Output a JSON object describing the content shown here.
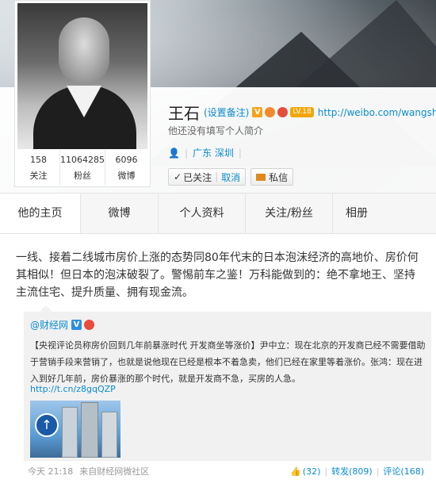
{
  "profile": {
    "name": "王石",
    "remark": "(设置备注)",
    "level": "LV.18",
    "url": "http://weibo.com/wangshi",
    "intro": "他还没有填写个人简介",
    "location": "广东 深圳",
    "follow_state": "已关注",
    "cancel_label": "取消",
    "message_label": "私信",
    "stats": [
      {
        "num": "158",
        "label": "关注"
      },
      {
        "num": "11064285",
        "label": "粉丝"
      },
      {
        "num": "6096",
        "label": "微博"
      }
    ]
  },
  "tabs": [
    "他的主页",
    "微博",
    "个人资料",
    "关注/粉丝",
    "相册"
  ],
  "post": {
    "text": "一线、接着二线城市房价上涨的态势同80年代末的日本泡沫经济的高地价、房价何其相似！但日本的泡沫破裂了。警惕前车之鉴！万科能做到的：绝不拿地王、坚持主流住宅、提升质量、拥有现金流。",
    "repost": {
      "author": "@财经网",
      "text": "【央视评论员称房价回到几年前暴涨时代 开发商坐等涨价】尹中立：现在北京的开发商已经不需要借助于营销手段来营销了，也就是说他现在已经是根本不着急卖，他们已经在家里等着涨价。张鸿：现在进入到好几年前，房价暴涨的那个时代，就是开发商不急，买房的人急。",
      "link": "http://t.cn/z8gqQZP"
    },
    "time": "今天 21:18",
    "source": "来自财经网微社区",
    "likes": "(32)",
    "repost_label": "转发(809)",
    "comment_label": "评论(168)"
  }
}
